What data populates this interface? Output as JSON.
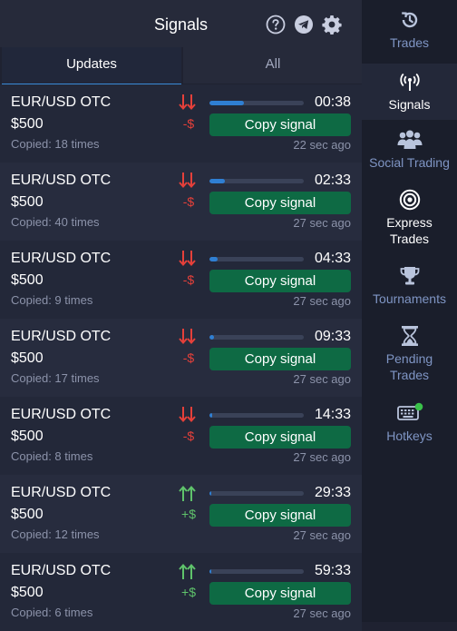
{
  "header": {
    "title": "Signals",
    "icons": [
      "help-icon",
      "telegram-icon",
      "settings-gear-icon"
    ]
  },
  "tabs": [
    {
      "label": "Updates",
      "active": true
    },
    {
      "label": "All",
      "active": false
    }
  ],
  "colors": {
    "accent_blue": "#2f7fd3",
    "copy_green": "#0e6a44",
    "down_red": "#e5403a",
    "up_green": "#5fc36b",
    "sidebar_label": "#7f95c4"
  },
  "signals": [
    {
      "pair": "EUR/USD OTC",
      "amount": "$500",
      "copied": "Copied: 18 times",
      "direction": "down",
      "dir_text": "-$",
      "timer": "00:38",
      "progress": 0.37,
      "button": "Copy signal",
      "ago": "22 sec ago"
    },
    {
      "pair": "EUR/USD OTC",
      "amount": "$500",
      "copied": "Copied: 40 times",
      "direction": "down",
      "dir_text": "-$",
      "timer": "02:33",
      "progress": 0.16,
      "button": "Copy signal",
      "ago": "27 sec ago"
    },
    {
      "pair": "EUR/USD OTC",
      "amount": "$500",
      "copied": "Copied: 9 times",
      "direction": "down",
      "dir_text": "-$",
      "timer": "04:33",
      "progress": 0.09,
      "button": "Copy signal",
      "ago": "27 sec ago"
    },
    {
      "pair": "EUR/USD OTC",
      "amount": "$500",
      "copied": "Copied: 17 times",
      "direction": "down",
      "dir_text": "-$",
      "timer": "09:33",
      "progress": 0.05,
      "button": "Copy signal",
      "ago": "27 sec ago"
    },
    {
      "pair": "EUR/USD OTC",
      "amount": "$500",
      "copied": "Copied: 8 times",
      "direction": "down",
      "dir_text": "-$",
      "timer": "14:33",
      "progress": 0.03,
      "button": "Copy signal",
      "ago": "27 sec ago"
    },
    {
      "pair": "EUR/USD OTC",
      "amount": "$500",
      "copied": "Copied: 12 times",
      "direction": "up",
      "dir_text": "+$",
      "timer": "29:33",
      "progress": 0.02,
      "button": "Copy signal",
      "ago": "27 sec ago"
    },
    {
      "pair": "EUR/USD OTC",
      "amount": "$500",
      "copied": "Copied: 6 times",
      "direction": "up",
      "dir_text": "+$",
      "timer": "59:33",
      "progress": 0.01,
      "button": "Copy signal",
      "ago": "27 sec ago"
    }
  ],
  "sidebar": {
    "items": [
      {
        "label": "Trades",
        "icon": "trades-history-icon"
      },
      {
        "label": "Signals",
        "icon": "signals-antenna-icon",
        "active": true
      },
      {
        "label": "Social Trading",
        "icon": "social-trading-icon"
      },
      {
        "label": "Express Trades",
        "line1": "Express",
        "line2": "Trades",
        "icon": "express-target-icon"
      },
      {
        "label": "Tournaments",
        "icon": "trophy-icon"
      },
      {
        "label": "Pending Trades",
        "line1": "Pending",
        "line2": "Trades",
        "icon": "hourglass-icon"
      },
      {
        "label": "Hotkeys",
        "icon": "keyboard-icon"
      }
    ]
  }
}
